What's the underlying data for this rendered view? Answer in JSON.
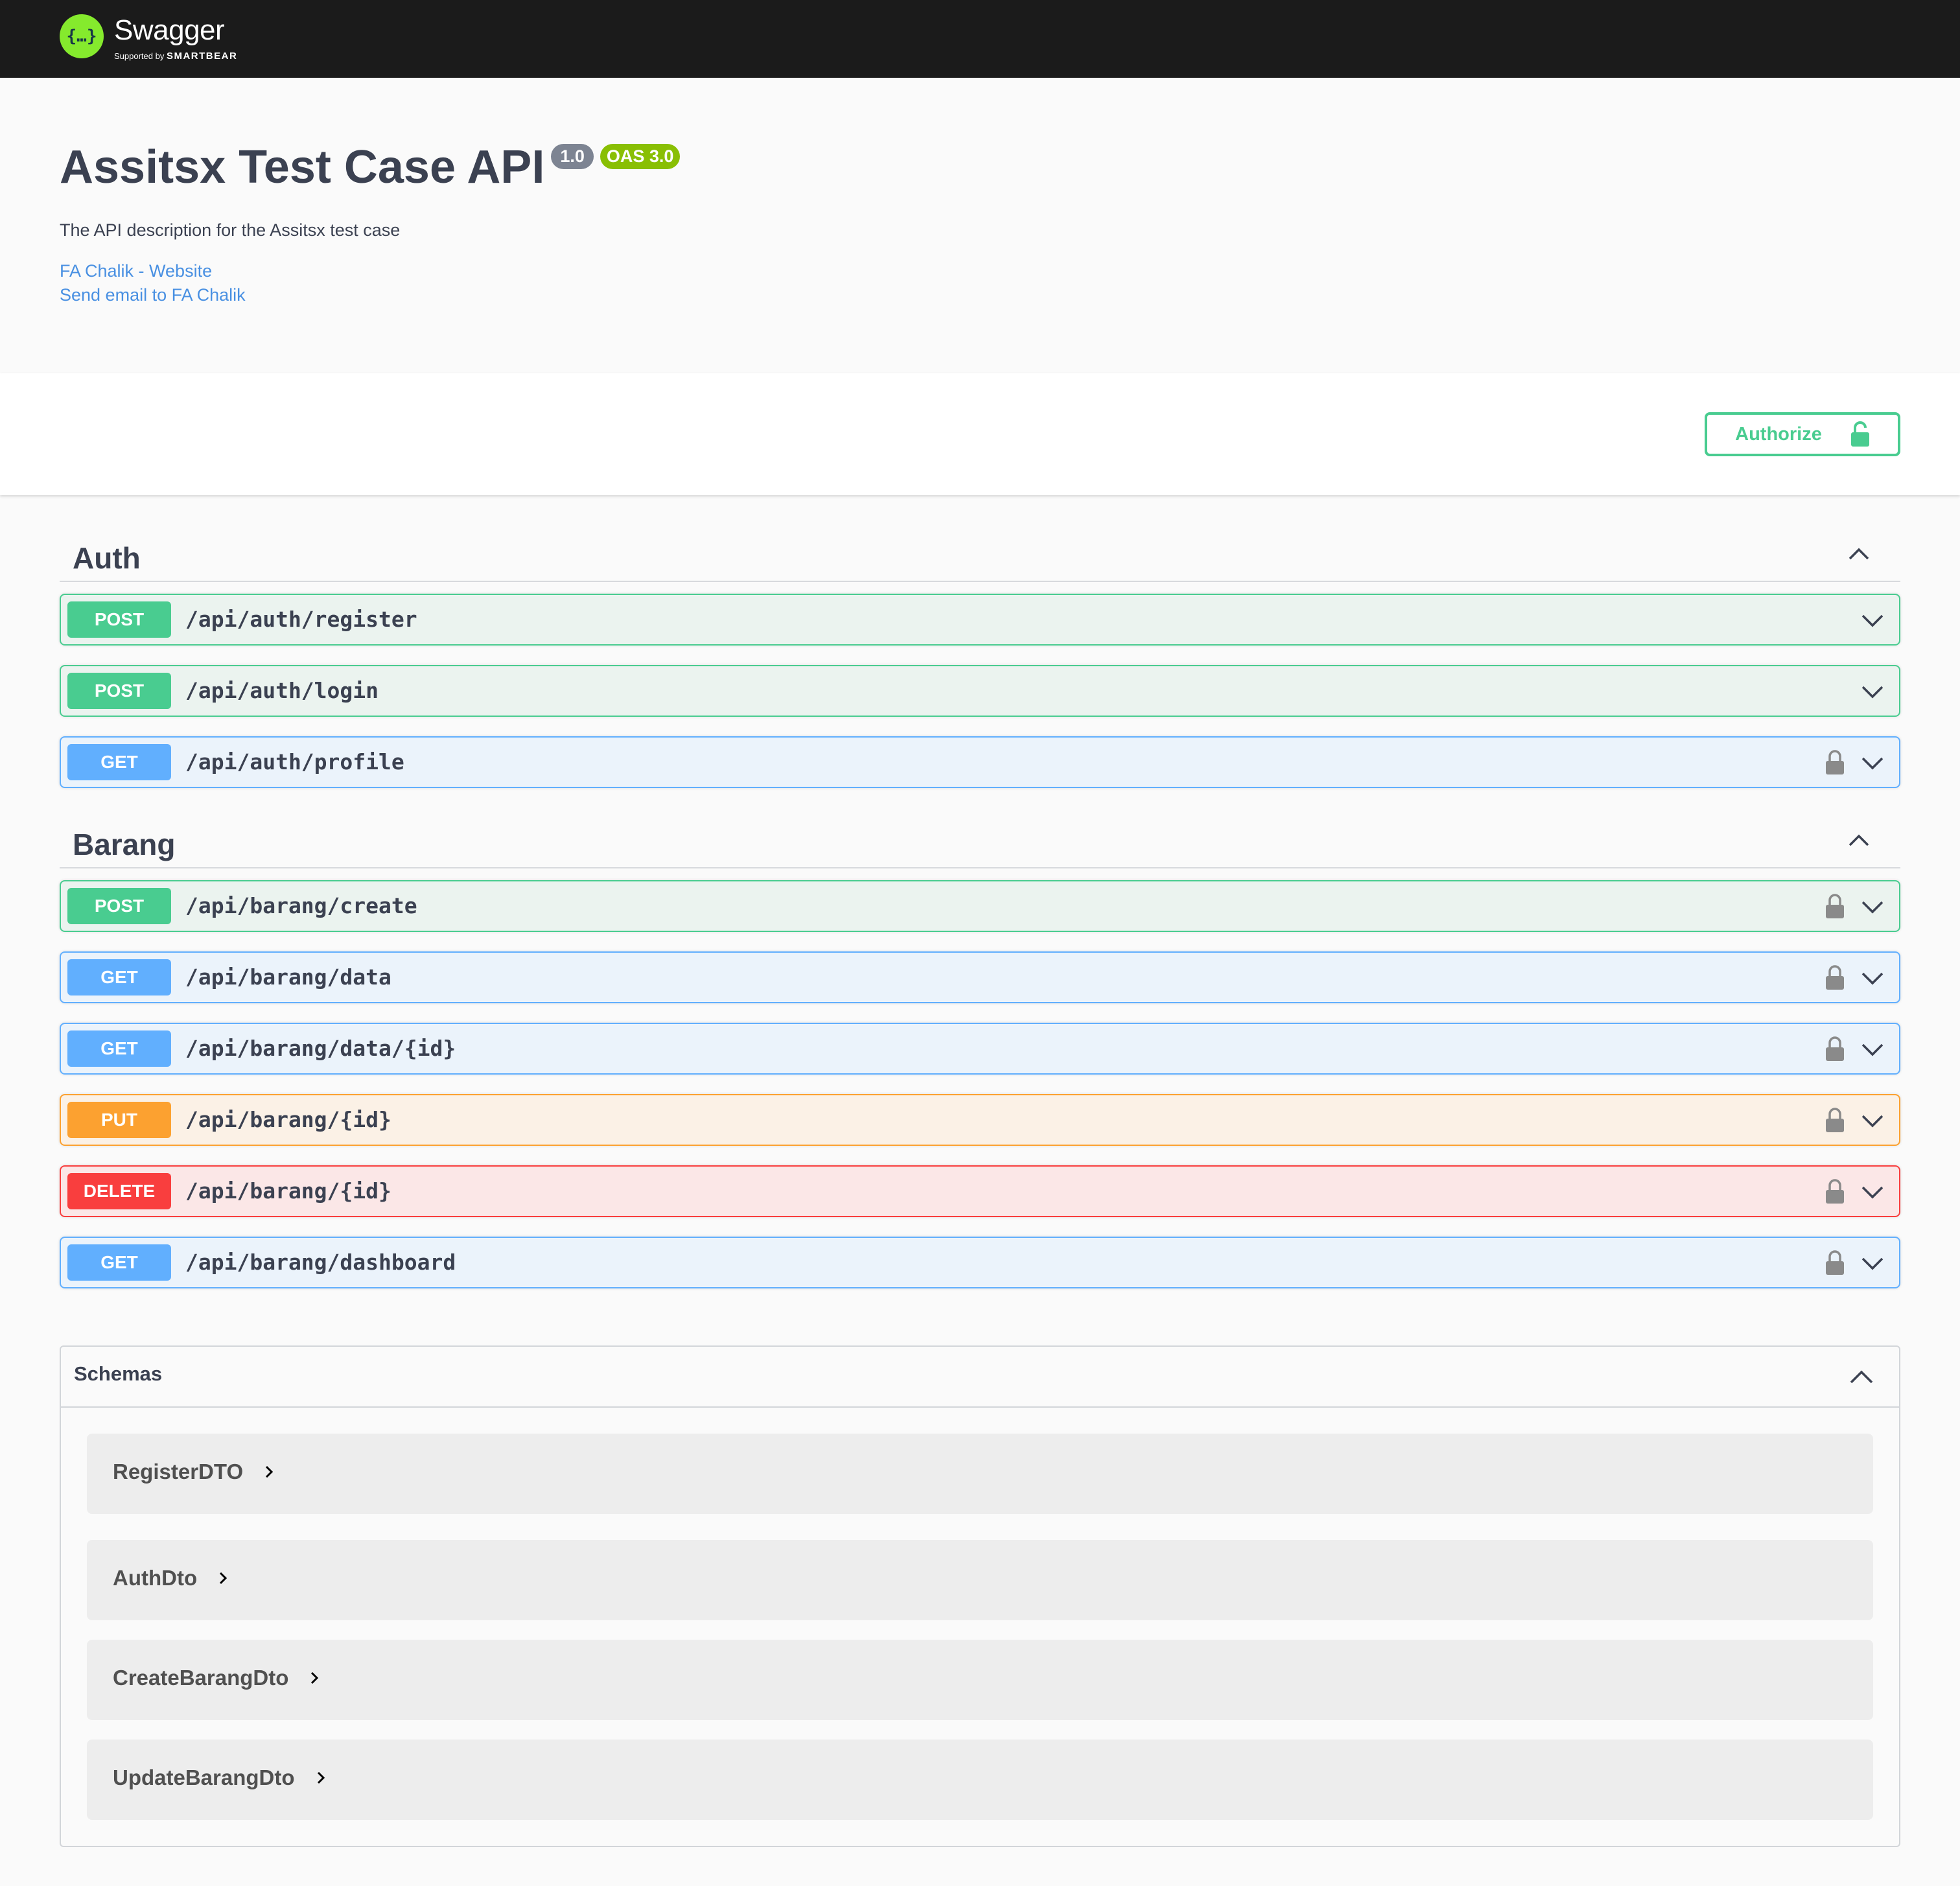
{
  "topbar": {
    "logo_glyph": "{…}",
    "logo_name": "Swagger",
    "supported_by": "Supported by",
    "smartbear": "SMARTBEAR"
  },
  "info": {
    "title": "Assitsx Test Case API",
    "version": "1.0",
    "oas": "OAS 3.0",
    "description": "The API description for the Assitsx test case",
    "link_website": "FA Chalik - Website",
    "link_email": "Send email to FA Chalik"
  },
  "authorize": {
    "label": "Authorize",
    "icon": "unlock-icon"
  },
  "tags": [
    {
      "name": "Auth",
      "operations": [
        {
          "method": "POST",
          "path": "/api/auth/register",
          "locked": false
        },
        {
          "method": "POST",
          "path": "/api/auth/login",
          "locked": false
        },
        {
          "method": "GET",
          "path": "/api/auth/profile",
          "locked": true
        }
      ]
    },
    {
      "name": "Barang",
      "operations": [
        {
          "method": "POST",
          "path": "/api/barang/create",
          "locked": true
        },
        {
          "method": "GET",
          "path": "/api/barang/data",
          "locked": true
        },
        {
          "method": "GET",
          "path": "/api/barang/data/{id}",
          "locked": true
        },
        {
          "method": "PUT",
          "path": "/api/barang/{id}",
          "locked": true
        },
        {
          "method": "DELETE",
          "path": "/api/barang/{id}",
          "locked": true
        },
        {
          "method": "GET",
          "path": "/api/barang/dashboard",
          "locked": true
        }
      ]
    }
  ],
  "schemas": {
    "title": "Schemas",
    "models": [
      "RegisterDTO",
      "AuthDto",
      "CreateBarangDto",
      "UpdateBarangDto"
    ]
  },
  "colors": {
    "post": "#49cc90",
    "get": "#61affe",
    "put": "#fca130",
    "delete": "#f93e3e",
    "topbar": "#1b1b1b",
    "link": "#4990e2"
  }
}
